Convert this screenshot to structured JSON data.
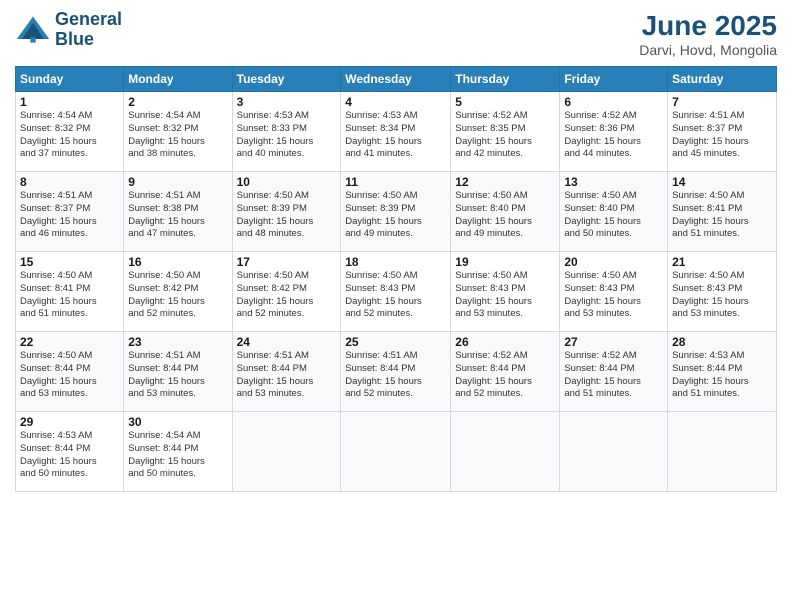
{
  "header": {
    "logo_line1": "General",
    "logo_line2": "Blue",
    "title": "June 2025",
    "subtitle": "Darvi, Hovd, Mongolia"
  },
  "weekdays": [
    "Sunday",
    "Monday",
    "Tuesday",
    "Wednesday",
    "Thursday",
    "Friday",
    "Saturday"
  ],
  "weeks": [
    [
      {
        "day": "1",
        "info": "Sunrise: 4:54 AM\nSunset: 8:32 PM\nDaylight: 15 hours\nand 37 minutes."
      },
      {
        "day": "2",
        "info": "Sunrise: 4:54 AM\nSunset: 8:32 PM\nDaylight: 15 hours\nand 38 minutes."
      },
      {
        "day": "3",
        "info": "Sunrise: 4:53 AM\nSunset: 8:33 PM\nDaylight: 15 hours\nand 40 minutes."
      },
      {
        "day": "4",
        "info": "Sunrise: 4:53 AM\nSunset: 8:34 PM\nDaylight: 15 hours\nand 41 minutes."
      },
      {
        "day": "5",
        "info": "Sunrise: 4:52 AM\nSunset: 8:35 PM\nDaylight: 15 hours\nand 42 minutes."
      },
      {
        "day": "6",
        "info": "Sunrise: 4:52 AM\nSunset: 8:36 PM\nDaylight: 15 hours\nand 44 minutes."
      },
      {
        "day": "7",
        "info": "Sunrise: 4:51 AM\nSunset: 8:37 PM\nDaylight: 15 hours\nand 45 minutes."
      }
    ],
    [
      {
        "day": "8",
        "info": "Sunrise: 4:51 AM\nSunset: 8:37 PM\nDaylight: 15 hours\nand 46 minutes."
      },
      {
        "day": "9",
        "info": "Sunrise: 4:51 AM\nSunset: 8:38 PM\nDaylight: 15 hours\nand 47 minutes."
      },
      {
        "day": "10",
        "info": "Sunrise: 4:50 AM\nSunset: 8:39 PM\nDaylight: 15 hours\nand 48 minutes."
      },
      {
        "day": "11",
        "info": "Sunrise: 4:50 AM\nSunset: 8:39 PM\nDaylight: 15 hours\nand 49 minutes."
      },
      {
        "day": "12",
        "info": "Sunrise: 4:50 AM\nSunset: 8:40 PM\nDaylight: 15 hours\nand 49 minutes."
      },
      {
        "day": "13",
        "info": "Sunrise: 4:50 AM\nSunset: 8:40 PM\nDaylight: 15 hours\nand 50 minutes."
      },
      {
        "day": "14",
        "info": "Sunrise: 4:50 AM\nSunset: 8:41 PM\nDaylight: 15 hours\nand 51 minutes."
      }
    ],
    [
      {
        "day": "15",
        "info": "Sunrise: 4:50 AM\nSunset: 8:41 PM\nDaylight: 15 hours\nand 51 minutes."
      },
      {
        "day": "16",
        "info": "Sunrise: 4:50 AM\nSunset: 8:42 PM\nDaylight: 15 hours\nand 52 minutes."
      },
      {
        "day": "17",
        "info": "Sunrise: 4:50 AM\nSunset: 8:42 PM\nDaylight: 15 hours\nand 52 minutes."
      },
      {
        "day": "18",
        "info": "Sunrise: 4:50 AM\nSunset: 8:43 PM\nDaylight: 15 hours\nand 52 minutes."
      },
      {
        "day": "19",
        "info": "Sunrise: 4:50 AM\nSunset: 8:43 PM\nDaylight: 15 hours\nand 53 minutes."
      },
      {
        "day": "20",
        "info": "Sunrise: 4:50 AM\nSunset: 8:43 PM\nDaylight: 15 hours\nand 53 minutes."
      },
      {
        "day": "21",
        "info": "Sunrise: 4:50 AM\nSunset: 8:43 PM\nDaylight: 15 hours\nand 53 minutes."
      }
    ],
    [
      {
        "day": "22",
        "info": "Sunrise: 4:50 AM\nSunset: 8:44 PM\nDaylight: 15 hours\nand 53 minutes."
      },
      {
        "day": "23",
        "info": "Sunrise: 4:51 AM\nSunset: 8:44 PM\nDaylight: 15 hours\nand 53 minutes."
      },
      {
        "day": "24",
        "info": "Sunrise: 4:51 AM\nSunset: 8:44 PM\nDaylight: 15 hours\nand 53 minutes."
      },
      {
        "day": "25",
        "info": "Sunrise: 4:51 AM\nSunset: 8:44 PM\nDaylight: 15 hours\nand 52 minutes."
      },
      {
        "day": "26",
        "info": "Sunrise: 4:52 AM\nSunset: 8:44 PM\nDaylight: 15 hours\nand 52 minutes."
      },
      {
        "day": "27",
        "info": "Sunrise: 4:52 AM\nSunset: 8:44 PM\nDaylight: 15 hours\nand 51 minutes."
      },
      {
        "day": "28",
        "info": "Sunrise: 4:53 AM\nSunset: 8:44 PM\nDaylight: 15 hours\nand 51 minutes."
      }
    ],
    [
      {
        "day": "29",
        "info": "Sunrise: 4:53 AM\nSunset: 8:44 PM\nDaylight: 15 hours\nand 50 minutes."
      },
      {
        "day": "30",
        "info": "Sunrise: 4:54 AM\nSunset: 8:44 PM\nDaylight: 15 hours\nand 50 minutes."
      },
      {
        "day": "",
        "info": ""
      },
      {
        "day": "",
        "info": ""
      },
      {
        "day": "",
        "info": ""
      },
      {
        "day": "",
        "info": ""
      },
      {
        "day": "",
        "info": ""
      }
    ]
  ]
}
